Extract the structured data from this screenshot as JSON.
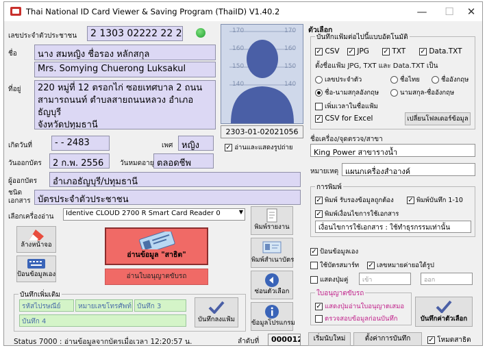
{
  "window": {
    "title": "Thai National ID Card Viewer & Saving Program (ThaiID) V1.40.2",
    "minimize": "—",
    "maximize": "☐",
    "close": "✕"
  },
  "card": {
    "id_label": "เลขประจำตัวประชาชน",
    "id_value": "2 1303 02222 22 2",
    "name_label": "ชื่อ",
    "name_th": "นาง สมหญิง ชื่อรอง หลักสกุล",
    "name_en": "Mrs. Somying Chuerong Luksakul",
    "address_label": "ที่อยู่",
    "address": [
      "220 หมู่ที่ 12 ตรอกไก่ ซอยเทศบาล 2 ถนน",
      "สามารถนนท์ ตำบลสายถนนหลวง อำเภอธัญบุรี",
      "จังหวัดปทุมธานี"
    ],
    "birth_label": "เกิดวันที่",
    "birth_value": "- - 2483",
    "sex_label": "เพศ",
    "sex_value": "หญิง",
    "issue_label": "วันออกบัตร",
    "issue_value": "2 ก.พ. 2556",
    "expire_label": "วันหมดอายุ",
    "expire_value": "ตลอดชีพ",
    "issuer_label": "ผู้ออกบัตร",
    "issuer_value": "อำเภอธัญบุรี/ปทุมธานี",
    "doctype_label": [
      "ชนิด",
      "เอกสาร"
    ],
    "doctype_value": "บัตรประจำตัวประชาชน",
    "photo_code": "2303-01-02021056",
    "photo_scale": [
      "170",
      "160",
      "150",
      "140"
    ],
    "read_show_photo": "อ่านและแสดงรูปถ่าย"
  },
  "reader": {
    "label": "เลือกเครื่องอ่าน",
    "selected": "Identive CLOUD 2700 R Smart Card Reader 0"
  },
  "buttons": {
    "clear": "ล้างหน้าจอ",
    "keyboard": "ป้อนข้อมูลเอง",
    "read_card": "อ่านข้อมูล \"สาธิต\"",
    "read_license": "อ่านใบอนุญาตขับรถ",
    "print_report": "พิมพ์รายงาน",
    "print_card": "พิมพ์สำเนาบัตร",
    "back_options": "ซ่อนตัวเลือก",
    "about": "ข้อมูลโปรแกรม",
    "save_extra": "บันทึกลงแฟ้ม",
    "save_default": "บันทึกค่าตัวเลือก",
    "new_start": "เริ่มนับใหม่",
    "save_settings": "ตั้งค่าการบันทึก"
  },
  "extra_group": {
    "title": "บันทึกเพิ่มเติม",
    "fields": [
      "รหัสไปรษณีย์",
      "หมายเลขโทรศัพท์",
      "บันทึก 3",
      "บันทึก 4"
    ]
  },
  "status": {
    "text": "Status 7000 : อ่านข้อมูลจากบัตรเมื่อเวลา 12:20:57 น.",
    "seq_label": "ลำดับที่",
    "seq_value": "000012",
    "demo_mode": "โหมดสาธิต"
  },
  "options": {
    "title": "ตัวเลือก",
    "autosave_title": "บันทึกแฟ้มต่อไปนี้แบบอัตโนมัติ",
    "formats": [
      "CSV",
      "JPG",
      "TXT",
      "Data.TXT"
    ],
    "name_hint": "ตั้งชื่อแฟ้ม JPG, TXT และ Data.TXT เป็น",
    "radio_options": [
      "เลขประจำตัว",
      "ชื่อไทย",
      "ชื่ออังกฤษ",
      "ชื่อ-นามสกุลอังกฤษ",
      "นามสกุล-ชื่ออังกฤษ"
    ],
    "add_time": "เพิ่มเวลาในชื่อแฟ้ม",
    "csv_excel": "CSV for Excel",
    "open_folder": "เปลี่ยนโฟลเดอร์ข้อมูล",
    "device_label": "ชื่อเครื่อง/จุดตรวจ/สาขา",
    "device_value": "King Power สาขารางน้ำ",
    "note_label": "หมายเหตุ",
    "note_value": "แผนกเครื่องสำอางค์",
    "print_title": "การพิมพ์",
    "print_check": "พิมพ์ รับรองข้อมูลถูกต้อง",
    "print_memo": "พิมพ์บันทึก 1-10",
    "print_purpose_check": "พิมพ์เงื่อนไขการใช้เอกสาร",
    "print_purpose_value": "เงื่อนไขการใช้เอกสาร : ใช้ทำธุรกรรมเท่านั้น",
    "manual_input": "ป้อนข้อมูลเอง",
    "use_card": "ใช้บัตรสมาร์ท",
    "auto_id": "เลขหมายค่ายอใต้รูป",
    "show_code": "แสดงปุ่มคู่",
    "code_placeholder_a": "เข้า",
    "code_placeholder_b": "ออก",
    "license_title": "ใบอนุญาตขับรถ",
    "license_opt1": "แสดงปุ่มอ่านใบอนุญาตเสมอ",
    "license_opt2": "ตรวจสอบข้อมูลก่อนบันทึก"
  }
}
